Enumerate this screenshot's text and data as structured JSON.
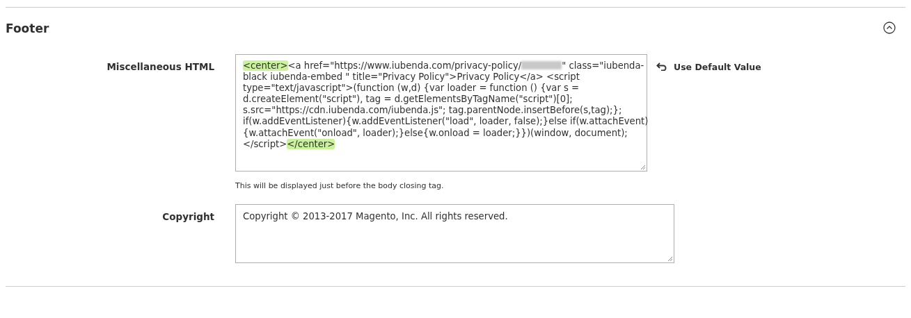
{
  "section": {
    "title": "Footer",
    "expanded": true
  },
  "fields": [
    {
      "label": "Miscellaneous HTML",
      "lines": [
        [
          {
            "kind": "text",
            "text": "<center>",
            "highlighted": true
          },
          {
            "kind": "text",
            "text": "<a href=\"https://www.iubenda.com/privacy-policy/",
            "highlighted": false
          },
          {
            "kind": "redacted"
          },
          {
            "kind": "text",
            "text": "\" class=\"iubenda-",
            "highlighted": false
          }
        ],
        [
          {
            "kind": "text",
            "text": "black iubenda-embed \" title=\"Privacy Policy\">Privacy Policy</a> <script",
            "highlighted": false
          }
        ],
        [
          {
            "kind": "text",
            "text": "type=\"text/javascript\">(function (w,d) {var loader = function () {var s =",
            "highlighted": false
          }
        ],
        [
          {
            "kind": "text",
            "text": "d.createElement(\"script\"), tag = d.getElementsByTagName(\"script\")[0];",
            "highlighted": false
          }
        ],
        [
          {
            "kind": "text",
            "text": "s.src=\"https://cdn.iubenda.com/iubenda.js\"; tag.parentNode.insertBefore(s,tag);};",
            "highlighted": false
          }
        ],
        [
          {
            "kind": "text",
            "text": "if(w.addEventListener){w.addEventListener(\"load\", loader, false);}else if(w.attachEvent)",
            "highlighted": false
          }
        ],
        [
          {
            "kind": "text",
            "text": "{w.attachEvent(\"onload\", loader);}else{w.onload = loader;}})(window, document);",
            "highlighted": false
          }
        ],
        [
          {
            "kind": "text",
            "text": "</script>",
            "highlighted": false
          },
          {
            "kind": "text",
            "text": "</center>",
            "highlighted": true
          }
        ]
      ],
      "note": "This will be displayed just before the body closing tag.",
      "default_action": "Use Default Value"
    },
    {
      "label": "Copyright",
      "lines": [
        [
          {
            "kind": "text",
            "text": "Copyright © 2013-2017 Magento, Inc. All rights reserved.",
            "highlighted": false
          }
        ]
      ]
    }
  ]
}
